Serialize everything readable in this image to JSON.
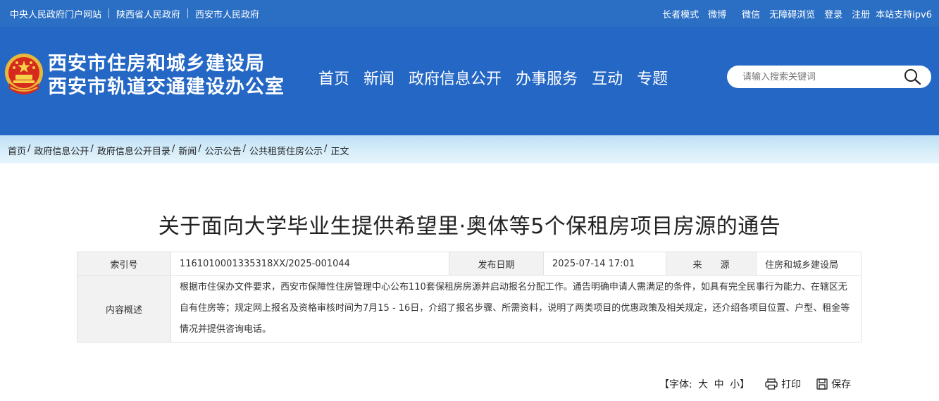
{
  "topbar": {
    "links": [
      "中央人民政府门户网站",
      "陕西省人民政府",
      "西安市人民政府"
    ],
    "right_links": [
      "长者模式",
      "微博",
      "微信",
      "无障碍浏览",
      "登录",
      "注册"
    ],
    "ipv6": "本站支持ipv6"
  },
  "header": {
    "org_line1": "西安市住房和城乡建设局",
    "org_line2": "西安市轨道交通建设办公室",
    "nav": [
      "首页",
      "新闻",
      "政府信息公开",
      "办事服务",
      "互动",
      "专题"
    ],
    "search_placeholder": "请输入搜索关键词"
  },
  "breadcrumb": [
    "首页",
    "政府信息公开",
    "政府信息公开目录",
    "新闻",
    "公示公告",
    "公共租赁住房公示",
    "正文"
  ],
  "article": {
    "title": "关于面向大学毕业生提供希望里·奥体等5个保租房项目房源的通告",
    "meta": {
      "index_label": "索引号",
      "index_value": "1161010001335318XX/2025-001044",
      "date_label": "发布日期",
      "date_value": "2025-07-14 17:01",
      "source_label": "来　　源",
      "source_value": "住房和城乡建设局",
      "summary_label": "内容概述",
      "summary_value": "根据市住保办文件要求，西安市保障性住房管理中心公布110套保租房房源并启动报名分配工作。通告明确申请人需满足的条件，如具有完全民事行为能力、在辖区无自有住房等；规定网上报名及资格审核时间为7月15 - 16日，介绍了报名步骤、所需资料，说明了两类项目的优惠政策及相关规定，还介绍各项目位置、户型、租金等情况并提供咨询电话。"
    }
  },
  "tools": {
    "font_label": "【字体:",
    "font_sizes": [
      "大",
      "中",
      "小"
    ],
    "font_close": "】",
    "print": "打印",
    "save": "保存"
  },
  "colors": {
    "topbar": "#2a6fc4",
    "header": "#2467c4",
    "crumbband": "#cfe8f8"
  }
}
